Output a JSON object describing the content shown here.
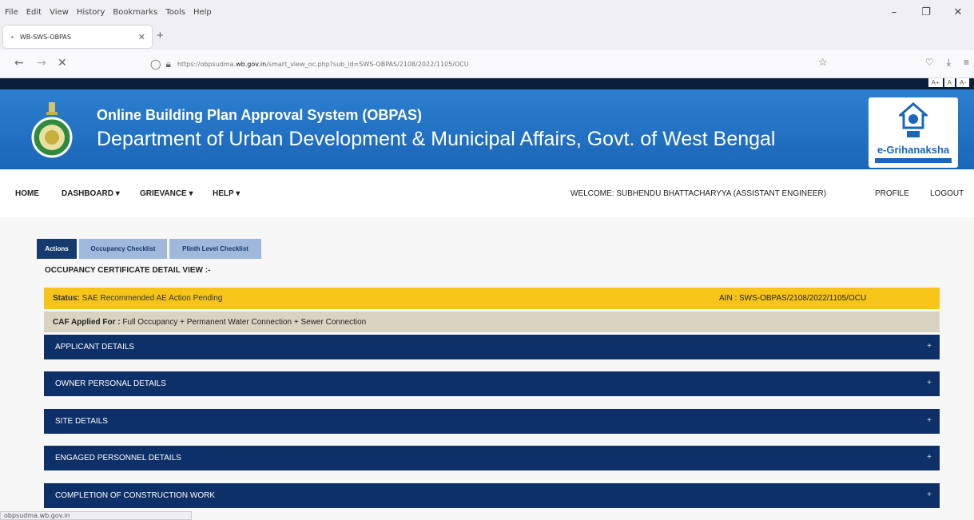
{
  "browser": {
    "menu": [
      "File",
      "Edit",
      "View",
      "History",
      "Bookmarks",
      "Tools",
      "Help"
    ],
    "tab_title": "WB-SWS-OBPAS",
    "url_prefix": "https://obpsudma.",
    "url_domain": "wb.gov.in",
    "url_suffix": "/smart_view_oc.php?sub_id=SWS-OBPAS/2108/2022/1105/OCU",
    "status_url": "obpsudma.wb.gov.in"
  },
  "accessibility": {
    "a_plus": "A+",
    "a": "A",
    "a_minus": "A-"
  },
  "header": {
    "title": "Online Building Plan Approval System (OBPAS)",
    "subtitle": "Department of Urban Development & Municipal Affairs, Govt. of West Bengal",
    "brand": "e-Grihanaksha"
  },
  "nav": {
    "home": "HOME",
    "dashboard": "DASHBOARD ▾",
    "grievance": "GRIEVANCE ▾",
    "help": "HELP ▾",
    "welcome": "WELCOME: SUBHENDU BHATTACHARYYA (ASSISTANT ENGINEER)",
    "profile": "PROFILE",
    "logout": "LOGOUT"
  },
  "tabs": {
    "actions": "Actions",
    "occupancy": "Occupancy Checklist",
    "plinth": "Plinth Level Checklist"
  },
  "page": {
    "heading": "OCCUPANCY CERTIFICATE DETAIL VIEW :-",
    "status_label": "Status:",
    "status_value": " SAE Recommended AE Action Pending",
    "ain": "AIN : SWS-OBPAS/2108/2022/1105/OCU",
    "caf_label": "CAF Applied For :",
    "caf_value": " Full Occupancy + Permanent Water Connection + Sewer Connection"
  },
  "sections": [
    "APPLICANT DETAILS",
    "OWNER PERSONAL DETAILS",
    "SITE DETAILS",
    "ENGAGED PERSONNEL DETAILS",
    "COMPLETION OF CONSTRUCTION WORK"
  ],
  "colors": {
    "header_blue": "#1b66b8",
    "accordion_navy": "#0e3068",
    "status_yellow": "#f7c51a"
  }
}
